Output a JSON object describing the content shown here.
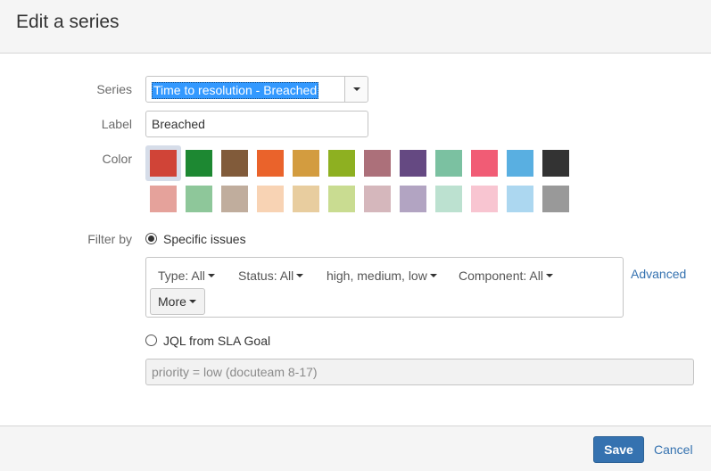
{
  "dialog": {
    "title": "Edit a series"
  },
  "form": {
    "series_label": "Series",
    "series_value": "Time to resolution - Breached",
    "label_label": "Label",
    "label_value": "Breached",
    "color_label": "Color",
    "filter_label": "Filter by",
    "colors_row1": [
      "#d04437",
      "#1d8832",
      "#815b3a",
      "#ea632b",
      "#d39c3f",
      "#8eb021",
      "#ac707a",
      "#654982",
      "#7bc1a1",
      "#f15c75",
      "#59afe1",
      "#333333"
    ],
    "colors_row2": [
      "#e5a29b",
      "#8ec79a",
      "#c0ad9d",
      "#f8d3b4",
      "#e8cd9f",
      "#c9dc91",
      "#d5b7bc",
      "#b2a4c2",
      "#bce1d0",
      "#f8c5d1",
      "#acd7f0",
      "#999999"
    ],
    "selected_color": "#d04437"
  },
  "filter": {
    "specific_issues_label": "Specific issues",
    "chips": [
      {
        "label": "Type: All"
      },
      {
        "label": "Status: All"
      },
      {
        "label": "high, medium, low"
      },
      {
        "label": "Component: All"
      }
    ],
    "more_label": "More",
    "advanced_label": "Advanced",
    "jql_option_label": "JQL from SLA Goal",
    "jql_value": "priority = low (docuteam 8-17)",
    "specific_selected": true
  },
  "footer": {
    "save_label": "Save",
    "cancel_label": "Cancel"
  }
}
